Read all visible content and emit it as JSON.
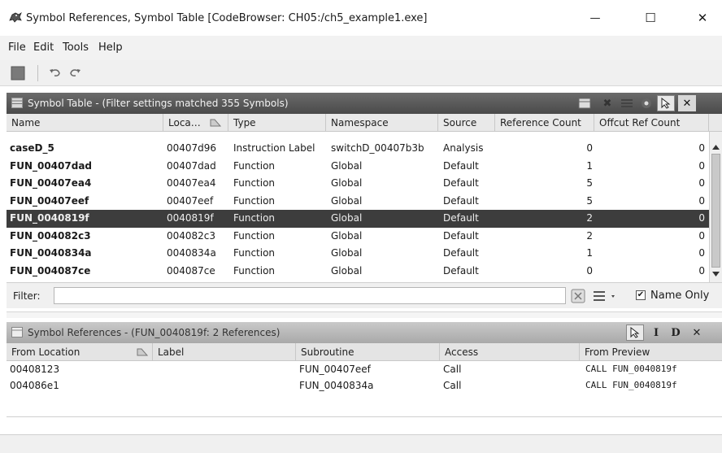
{
  "window": {
    "title": "Symbol References, Symbol Table [CodeBrowser: CH05:/ch5_example1.exe]",
    "minimize_glyph": "—",
    "maximize_glyph": "☐",
    "close_glyph": "✕"
  },
  "menu": [
    "File",
    "Edit",
    "Tools",
    "Help"
  ],
  "toolbar": {
    "icons": [
      "save-icon",
      "undo-icon",
      "redo-icon"
    ]
  },
  "symbol_table": {
    "title": "Symbol Table - (Filter settings matched 355 Symbols)",
    "columns": [
      "Name",
      "Loca…",
      "Type",
      "Namespace",
      "Source",
      "Reference Count",
      "Offcut Ref Count"
    ],
    "rows": [
      {
        "name": "caseD_5",
        "location": "00407d96",
        "type": "Instruction Label",
        "namespace": "switchD_00407b3b",
        "source": "Analysis",
        "ref_count": "0",
        "offcut": "0"
      },
      {
        "name": "FUN_00407dad",
        "location": "00407dad",
        "type": "Function",
        "namespace": "Global",
        "source": "Default",
        "ref_count": "1",
        "offcut": "0"
      },
      {
        "name": "FUN_00407ea4",
        "location": "00407ea4",
        "type": "Function",
        "namespace": "Global",
        "source": "Default",
        "ref_count": "5",
        "offcut": "0"
      },
      {
        "name": "FUN_00407eef",
        "location": "00407eef",
        "type": "Function",
        "namespace": "Global",
        "source": "Default",
        "ref_count": "5",
        "offcut": "0"
      },
      {
        "name": "FUN_0040819f",
        "location": "0040819f",
        "type": "Function",
        "namespace": "Global",
        "source": "Default",
        "ref_count": "2",
        "offcut": "0",
        "selected": true
      },
      {
        "name": "FUN_004082c3",
        "location": "004082c3",
        "type": "Function",
        "namespace": "Global",
        "source": "Default",
        "ref_count": "2",
        "offcut": "0"
      },
      {
        "name": "FUN_0040834a",
        "location": "0040834a",
        "type": "Function",
        "namespace": "Global",
        "source": "Default",
        "ref_count": "1",
        "offcut": "0"
      },
      {
        "name": "FUN_004087ce",
        "location": "004087ce",
        "type": "Function",
        "namespace": "Global",
        "source": "Default",
        "ref_count": "0",
        "offcut": "0"
      }
    ],
    "filter": {
      "label": "Filter:",
      "value": "",
      "name_only_label": "Name Only",
      "name_only_checked": true
    }
  },
  "symbol_references": {
    "title": "Symbol References - (FUN_0040819f: 2 References)",
    "columns": [
      "From Location",
      "Label",
      "Subroutine",
      "Access",
      "From Preview"
    ],
    "rows": [
      {
        "from_location": "00408123",
        "label": "",
        "subroutine": "FUN_00407eef",
        "access": "Call",
        "preview": "CALL FUN_0040819f"
      },
      {
        "from_location": "004086e1",
        "label": "",
        "subroutine": "FUN_0040834a",
        "access": "Call",
        "preview": "CALL FUN_0040819f"
      }
    ]
  },
  "colors": {
    "selected_row": "#3d3d3d",
    "header_dark": "#5a5a5a",
    "header_light": "#b9b9b9"
  }
}
